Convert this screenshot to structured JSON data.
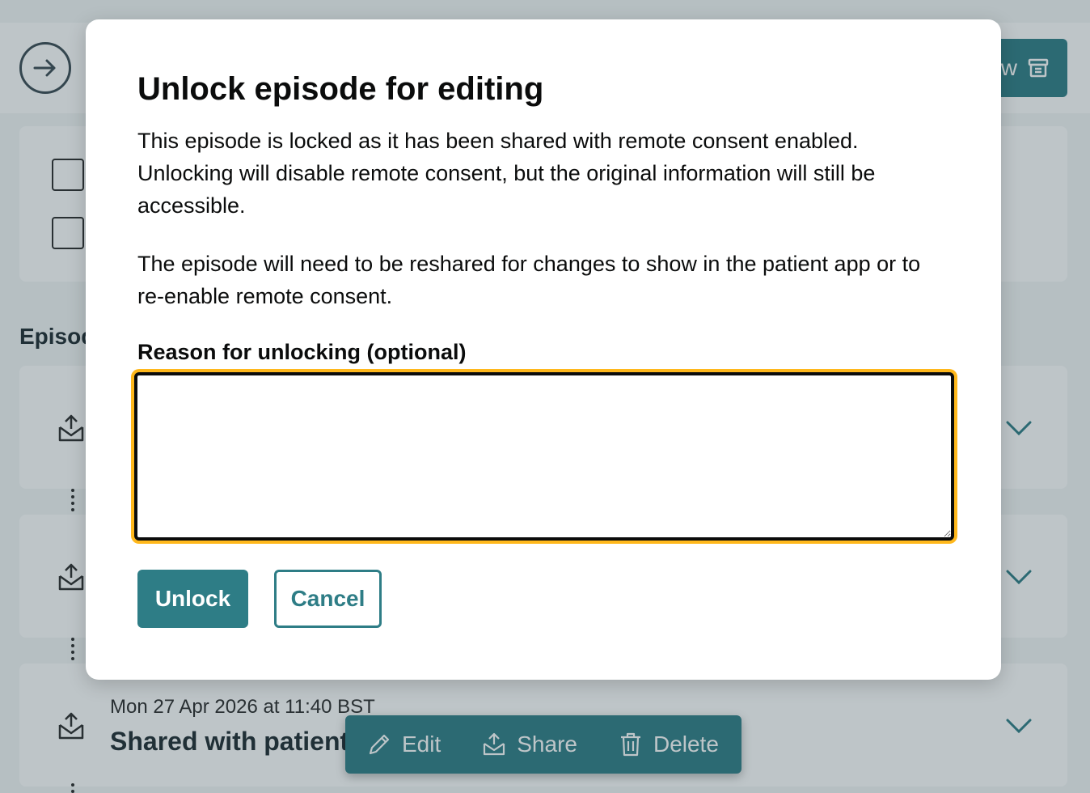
{
  "background": {
    "top_button_label": "View",
    "section_heading": "Episodes",
    "latest_episode": {
      "date": "Mon 27 Apr 2026 at 11:40 BST",
      "title": "Shared with patient"
    },
    "actions": {
      "edit": "Edit",
      "share": "Share",
      "delete": "Delete"
    },
    "icons": [
      "arrow-right-icon",
      "archive-icon",
      "outbox-icon",
      "chevron-down-icon",
      "pencil-icon",
      "share-icon",
      "trash-icon"
    ]
  },
  "modal": {
    "title": "Unlock episode for editing",
    "paragraph1": "This episode is locked as it has been shared with remote consent enabled. Unlocking will disable remote consent, but the original information will still be accessible.",
    "paragraph2": "The episode will need to be reshared for changes to show in the patient app or to re-enable remote consent.",
    "field_label": "Reason for unlocking (optional)",
    "field_value": "",
    "unlock_label": "Unlock",
    "cancel_label": "Cancel"
  },
  "colors": {
    "primary": "#2e7d86",
    "focus": "#ffb81c",
    "text": "#0b0c0c"
  }
}
